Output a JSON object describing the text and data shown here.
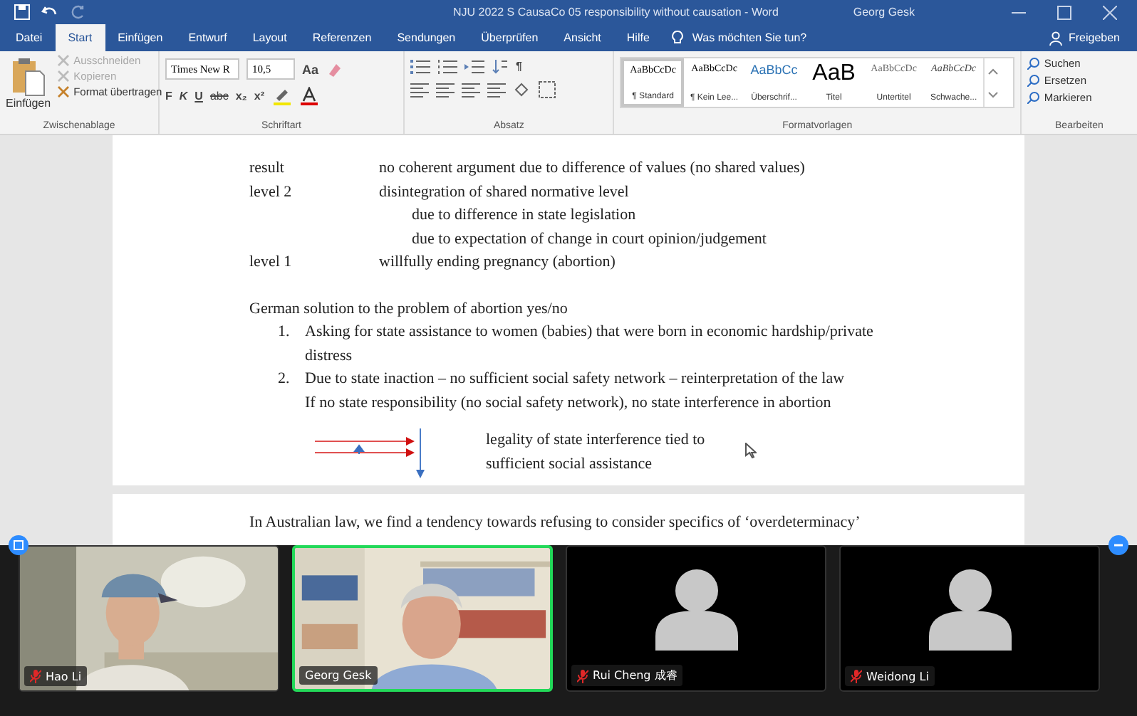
{
  "window": {
    "title": "NJU 2022 S CausaCo 05 responsibility without causation  -  Word",
    "user": "Georg Gesk"
  },
  "tabs": [
    {
      "label": "Datei",
      "selected": false
    },
    {
      "label": "Start",
      "selected": true
    },
    {
      "label": "Einfügen",
      "selected": false
    },
    {
      "label": "Entwurf",
      "selected": false
    },
    {
      "label": "Layout",
      "selected": false
    },
    {
      "label": "Referenzen",
      "selected": false
    },
    {
      "label": "Sendungen",
      "selected": false
    },
    {
      "label": "Überprüfen",
      "selected": false
    },
    {
      "label": "Ansicht",
      "selected": false
    },
    {
      "label": "Hilfe",
      "selected": false
    }
  ],
  "tell_me": {
    "placeholder": "Was möchten Sie tun?"
  },
  "share": "Freigeben",
  "clipboard": {
    "title": "Zwischenablage",
    "paste": "Einfügen",
    "items": [
      {
        "label": "Ausschneiden",
        "disabled": true
      },
      {
        "label": "Kopieren",
        "disabled": true
      },
      {
        "label": "Format übertragen",
        "disabled": false
      }
    ]
  },
  "font": {
    "title": "Schriftart",
    "name": "Times New R",
    "size": "10,5",
    "buttons": [
      "F",
      "K",
      "U",
      "abc",
      "x₂",
      "x²"
    ],
    "case": "Aa"
  },
  "paragraph": {
    "title": "Absatz",
    "pilcrow": "¶"
  },
  "styles": {
    "title": "Formatvorlagen",
    "items": [
      {
        "preview": "AaBbCcDc",
        "label": "¶ Standard",
        "kind": "normal",
        "selected": true
      },
      {
        "preview": "AaBbCcDc",
        "label": "¶ Kein Lee...",
        "kind": "normal",
        "selected": false
      },
      {
        "preview": "AaBbCc",
        "label": "Überschrif...",
        "kind": "heading",
        "selected": false
      },
      {
        "preview": "AaB",
        "label": "Titel",
        "kind": "title",
        "selected": false
      },
      {
        "preview": "AaBbCcDc",
        "label": "Untertitel",
        "kind": "subtitle",
        "selected": false
      },
      {
        "preview": "AaBbCcDc",
        "label": "Schwache...",
        "kind": "emphasis",
        "selected": false
      }
    ]
  },
  "editing": {
    "title": "Bearbeiten",
    "items": [
      "Suchen",
      "Ersetzen",
      "Markieren"
    ]
  },
  "document": {
    "outline": [
      {
        "label": "result",
        "text": "no coherent argument due to difference of values (no shared values)"
      },
      {
        "label": "level 2",
        "text": "disintegration of shared normative level",
        "children": [
          {
            "text": "due to difference in state legislation"
          },
          {
            "text": "due to expectation of change in court opinion/judgement"
          }
        ]
      },
      {
        "label": "level 1",
        "text": "willfully ending pregnancy (abortion)"
      }
    ],
    "heading": "German solution to the problem of abortion yes/no",
    "list": [
      {
        "number": "1.",
        "lines": [
          "Asking for state assistance to women (babies) that were born in economic hardship/private distress"
        ]
      },
      {
        "number": "2.",
        "lines": [
          "Due to state inaction – no sufficient social safety network – reinterpretation of the law",
          "If no state responsibility (no social safety network), no state interference in abortion"
        ]
      }
    ],
    "diagram_text": "legality of state interference tied to sufficient social assistance",
    "next_paragraph": "In Australian law, we find a tendency towards refusing to consider specifics of ‘overdeterminacy’"
  },
  "participants": [
    {
      "name": "Hao Li",
      "kind": "video",
      "muted": true,
      "speaking": false
    },
    {
      "name": "Georg Gesk",
      "kind": "video",
      "muted": false,
      "speaking": true
    },
    {
      "name": "Rui Cheng 成睿",
      "kind": "avatar",
      "muted": true,
      "speaking": false
    },
    {
      "name": "Weidong Li",
      "kind": "avatar",
      "muted": true,
      "speaking": false
    }
  ]
}
